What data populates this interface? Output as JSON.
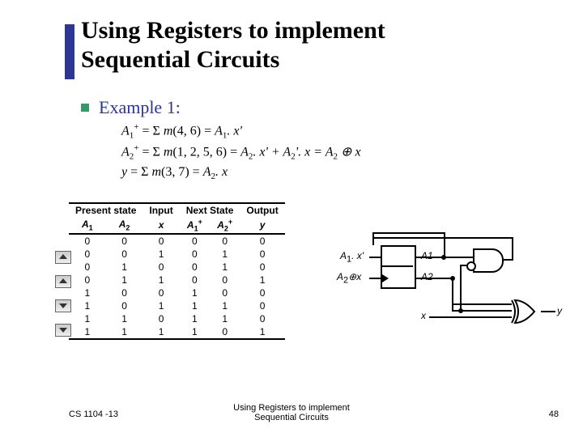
{
  "title_line1": "Using Registers to implement",
  "title_line2": "Sequential Circuits",
  "example_label": "Example 1:",
  "equations": {
    "line1_prefix": "A",
    "line1_rest": "+ = Σ m(4, 6) = A",
    "line1_tail": ". x'",
    "line2_prefix": "A",
    "line2_rest": "+ = Σ m(1, 2, 5, 6) = A",
    "line2_mid": ". x'  + A",
    "line2_tail": "'. x = A",
    "line2_xor": " ⊕ x",
    "line3_prefix": "y = Σ m(3, 7) = A",
    "line3_tail": ". x"
  },
  "table": {
    "group_headers": [
      "Present state",
      "Input",
      "Next State",
      "Output"
    ],
    "col_headers": [
      "A1",
      "A2",
      "x",
      "A1+",
      "A2+",
      "y"
    ],
    "rows": [
      [
        "0",
        "0",
        "0",
        "0",
        "0",
        "0"
      ],
      [
        "0",
        "0",
        "1",
        "0",
        "1",
        "0"
      ],
      [
        "0",
        "1",
        "0",
        "0",
        "1",
        "0"
      ],
      [
        "0",
        "1",
        "1",
        "0",
        "0",
        "1"
      ],
      [
        "1",
        "0",
        "0",
        "1",
        "0",
        "0"
      ],
      [
        "1",
        "0",
        "1",
        "1",
        "1",
        "0"
      ],
      [
        "1",
        "1",
        "0",
        "1",
        "1",
        "0"
      ],
      [
        "1",
        "1",
        "1",
        "1",
        "0",
        "1"
      ]
    ]
  },
  "circuit": {
    "in1": "A1. x'",
    "in2": "A2⊕x",
    "reg1": "A1",
    "reg2": "A2",
    "x": "x",
    "y": "y"
  },
  "footer": {
    "left": "CS 1104 -13",
    "center": "Using Registers to implement Sequential Circuits",
    "page": "48"
  }
}
